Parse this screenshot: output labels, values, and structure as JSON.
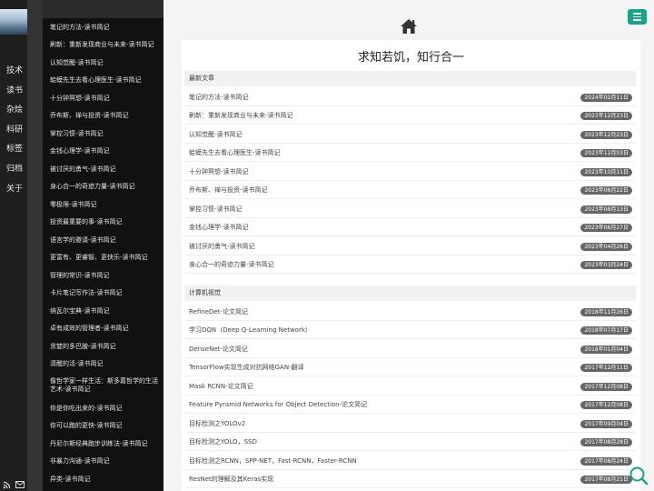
{
  "nav": {
    "items": [
      "技术",
      "读书",
      "杂烩",
      "科研",
      "标签",
      "归档",
      "关于"
    ],
    "bottom_icons": [
      "rss-icon",
      "mail-icon"
    ]
  },
  "post_list": [
    "笔记的方法-读书简记",
    "刷新：重新发现商业与未来-读书简记",
    "认知觉醒-读书简记",
    "蛤蟆先生去看心理医生-读书简记",
    "十分钟冥想-读书简记",
    "乔布斯、禅与投资-读书简记",
    "掌控习惯-读书简记",
    "金钱心理学-读书简记",
    "被讨厌的勇气-读书简记",
    "身心合一的奇迹力量-读书简记",
    "零极限-读书简记",
    "投资最重要的事-读书简记",
    "语言学的邀请-读书简记",
    "更富有、更睿智、更快乐-读书简记",
    "管理的常识-读书简记",
    "卡片笔记写作法-读书简记",
    "纳瓦尔宝典-读书简记",
    "卓有成效的管理者-读书简记",
    "贪婪的多巴胺-读书简记",
    "清醒的活-读书简记",
    "像哲学家一样生活：斯多葛哲学的生活艺术-读书简记",
    "你是你吃出来的-读书简记",
    "你可以跑的更快-读书简记",
    "丹尼尔斯经典跑步训练法-读书简记",
    "非暴力沟通-读书简记",
    "异类-读书简记"
  ],
  "header": {
    "home_icon": "home-icon",
    "menu_icon": "hamburger-icon"
  },
  "site": {
    "title": "求知若饥，知行合一"
  },
  "sections": [
    {
      "title": "最新文章",
      "posts": [
        {
          "title": "笔记的方法-读书简记",
          "date": "2024年02月11日"
        },
        {
          "title": "刷新：重新发现商业与未来-读书简记",
          "date": "2023年12月23日"
        },
        {
          "title": "认知觉醒-读书简记",
          "date": "2023年12月23日"
        },
        {
          "title": "蛤蟆先生去看心理医生-读书简记",
          "date": "2023年12月03日"
        },
        {
          "title": "十分钟冥想-读书简记",
          "date": "2023年10月11日"
        },
        {
          "title": "乔布斯、禅与投资-读书简记",
          "date": "2023年08月22日"
        },
        {
          "title": "掌控习惯-读书简记",
          "date": "2023年08月13日"
        },
        {
          "title": "金钱心理学-读书简记",
          "date": "2023年06月27日"
        },
        {
          "title": "被讨厌的勇气-读书简记",
          "date": "2023年04月26日"
        },
        {
          "title": "身心合一的奇迹力量-读书简记",
          "date": "2023年03月24日"
        }
      ]
    },
    {
      "title": "计算机视觉",
      "posts": [
        {
          "title": "RefineDet-论文简记",
          "date": "2018年11月26日"
        },
        {
          "title": "学习DQN（Deep Q-Learning Network）",
          "date": "2018年07月17日"
        },
        {
          "title": "DenseNet-论文简记",
          "date": "2018年01月04日"
        },
        {
          "title": "TensorFlow实现生成对抗网络GAN-翻译",
          "date": "2017年12月11日"
        },
        {
          "title": "Mask RCNN-论文简记",
          "date": "2017年12月08日"
        },
        {
          "title": "Feature Pyramid Networks for Object Detection-论文简记",
          "date": "2017年12月08日"
        },
        {
          "title": "目标检测之YOLOv2",
          "date": "2017年09月04日"
        },
        {
          "title": "目标检测之YOLO，SSD",
          "date": "2017年08月28日"
        },
        {
          "title": "目标检测之RCNN，SPP-NET，Fast-RCNN，Faster-RCNN",
          "date": "2017年08月24日"
        },
        {
          "title": "ResNet的理解及其Keras实现",
          "date": "2017年08月21日"
        }
      ]
    }
  ],
  "colors": {
    "accent": "#17a589",
    "badge": "#666666",
    "sidebar": "#1f1f1f",
    "postlist": "#111111"
  },
  "search_icon": "search-icon"
}
